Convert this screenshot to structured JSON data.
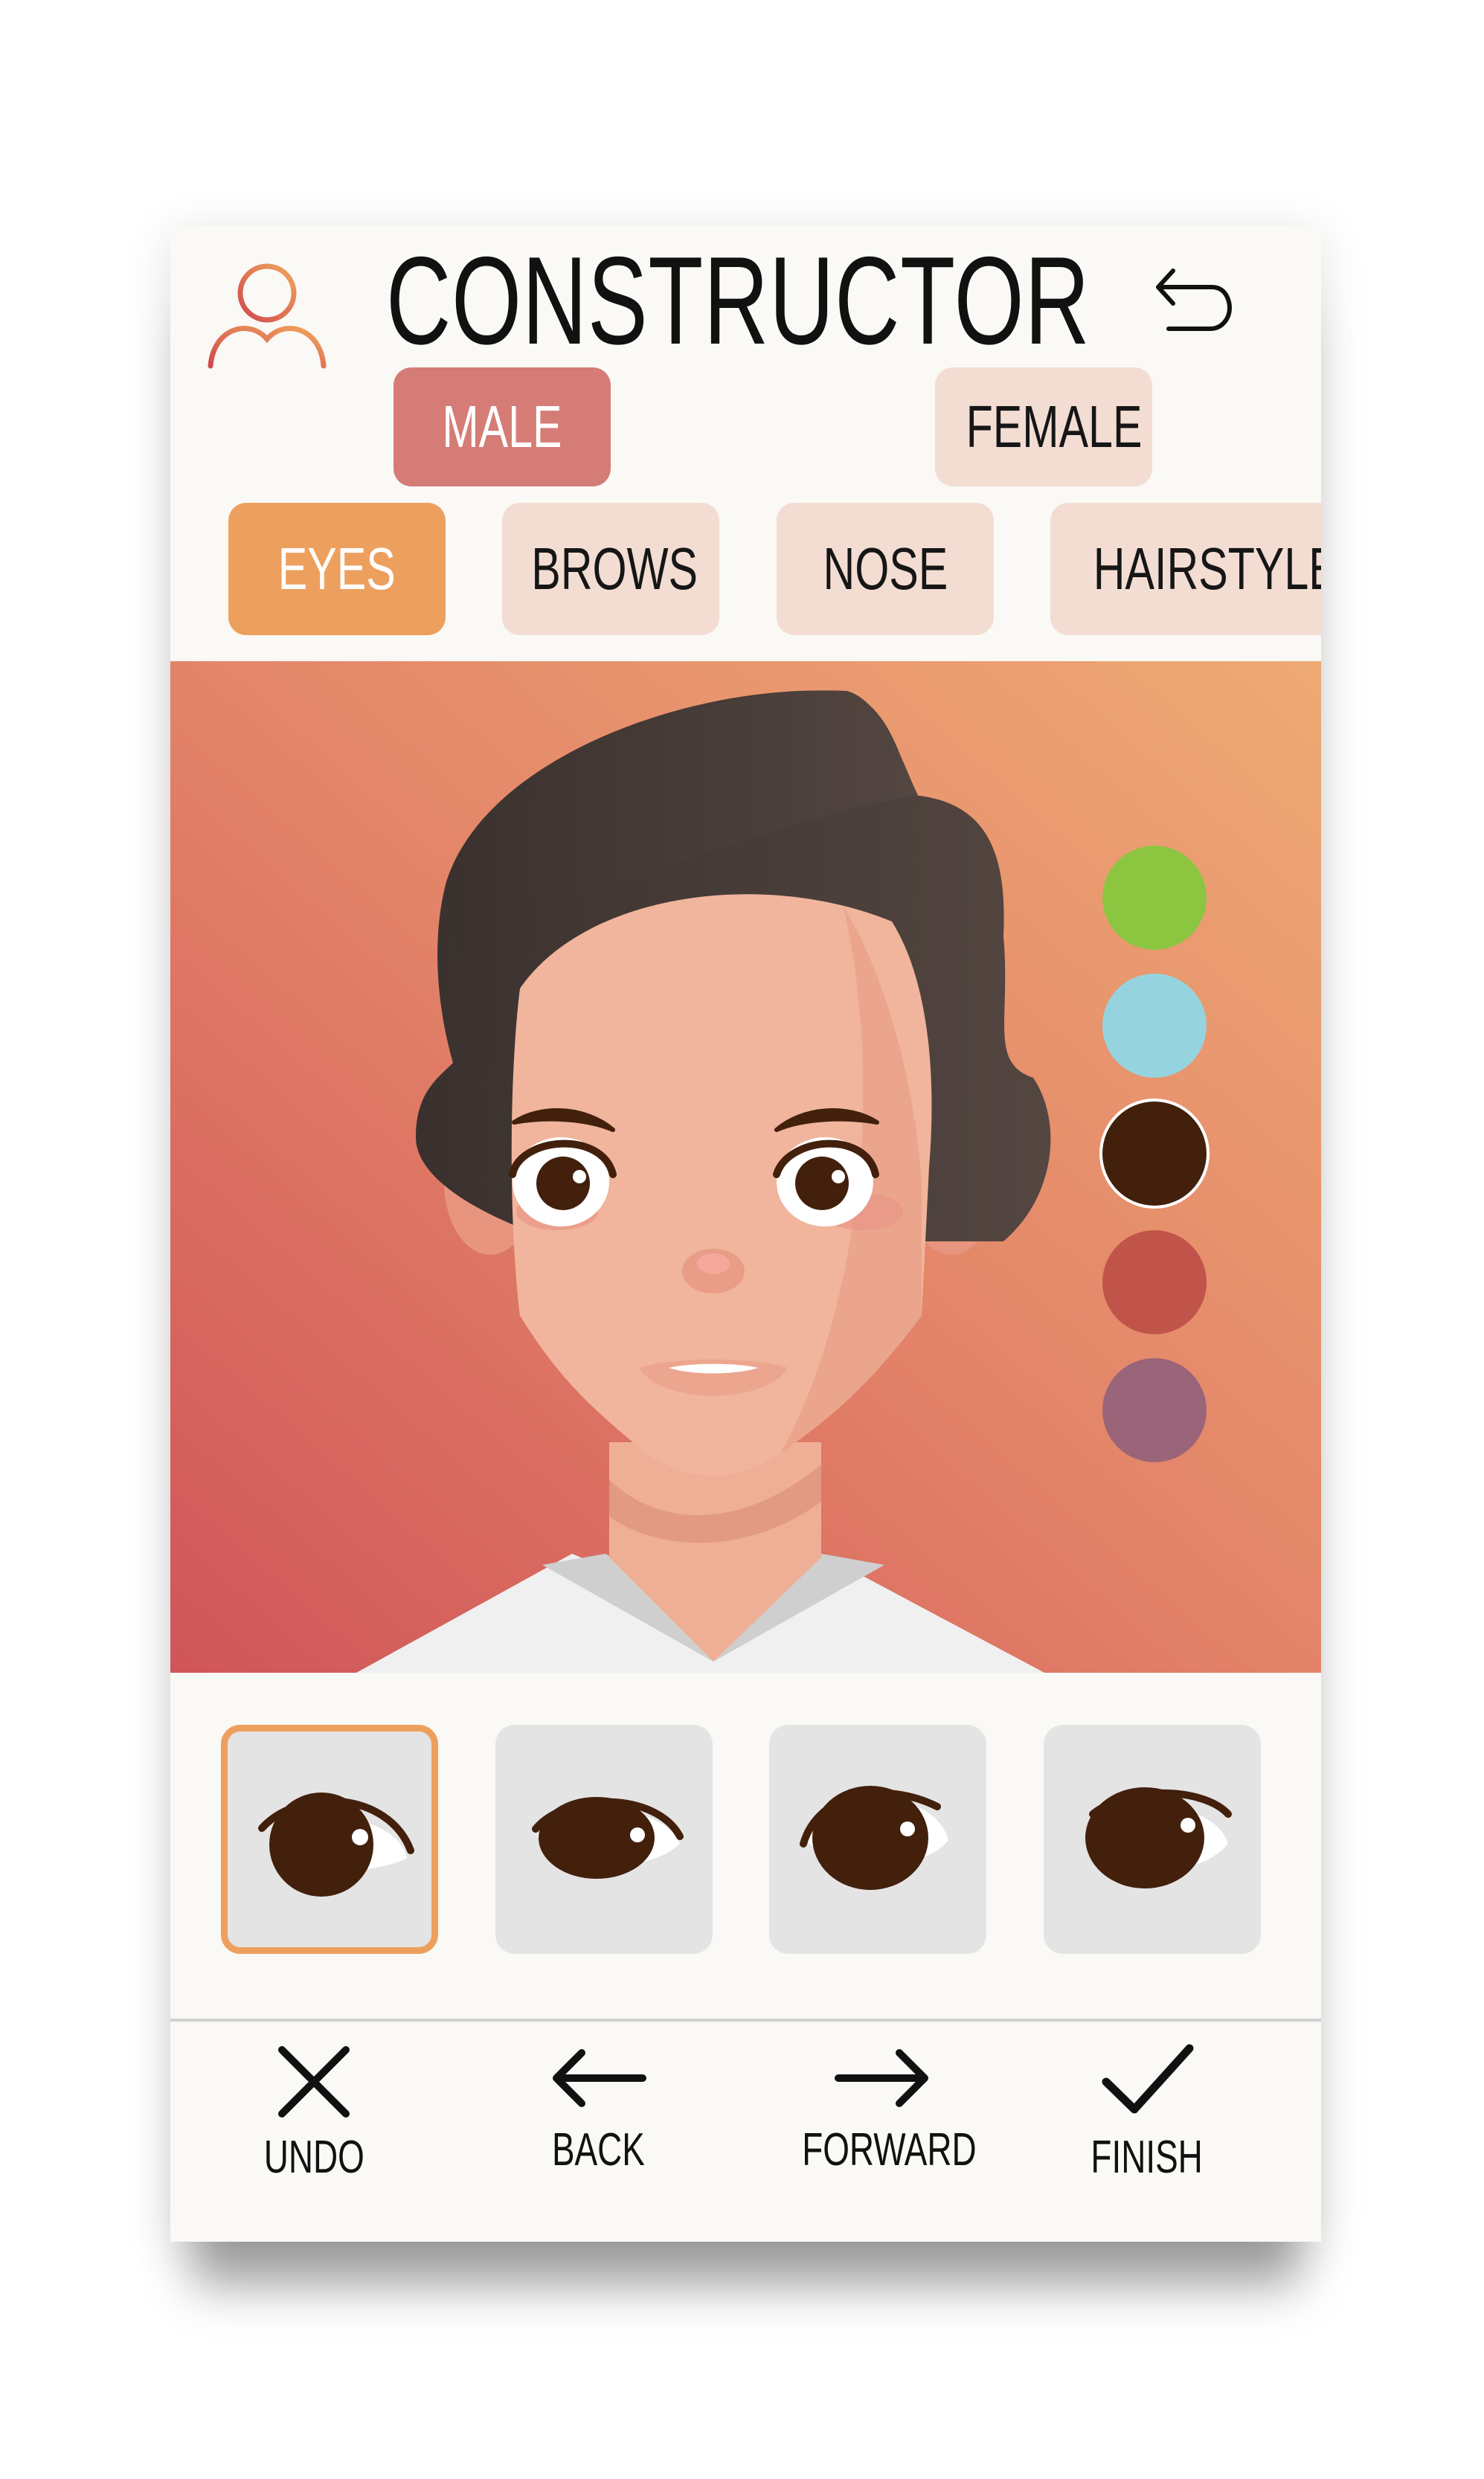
{
  "header": {
    "title": "CONSTRUCTOR",
    "user_icon": "user-icon",
    "back_icon": "return-arrow-icon"
  },
  "gender": {
    "options": [
      "MALE",
      "FEMALE"
    ],
    "selected": "MALE"
  },
  "categories": {
    "items": [
      "EYES",
      "BROWS",
      "NOSE",
      "HAIRSTYLE"
    ],
    "selected": "EYES"
  },
  "colors": {
    "swatches": [
      "#8cc540",
      "#95d4df",
      "#42200c",
      "#c0544a",
      "#9a6479"
    ],
    "selected_index": 2,
    "accent": "#eda05e",
    "gender_active": "#d57c76",
    "pill_inactive": "#f3ddd3"
  },
  "eye_options": {
    "count": 4,
    "selected_index": 0
  },
  "nav": {
    "undo": {
      "label": "UNDO",
      "icon": "close-icon"
    },
    "back": {
      "label": "BACK",
      "icon": "arrow-left-icon"
    },
    "forward": {
      "label": "FORWARD",
      "icon": "arrow-right-icon"
    },
    "finish": {
      "label": "FINISH",
      "icon": "checkmark-icon"
    }
  }
}
